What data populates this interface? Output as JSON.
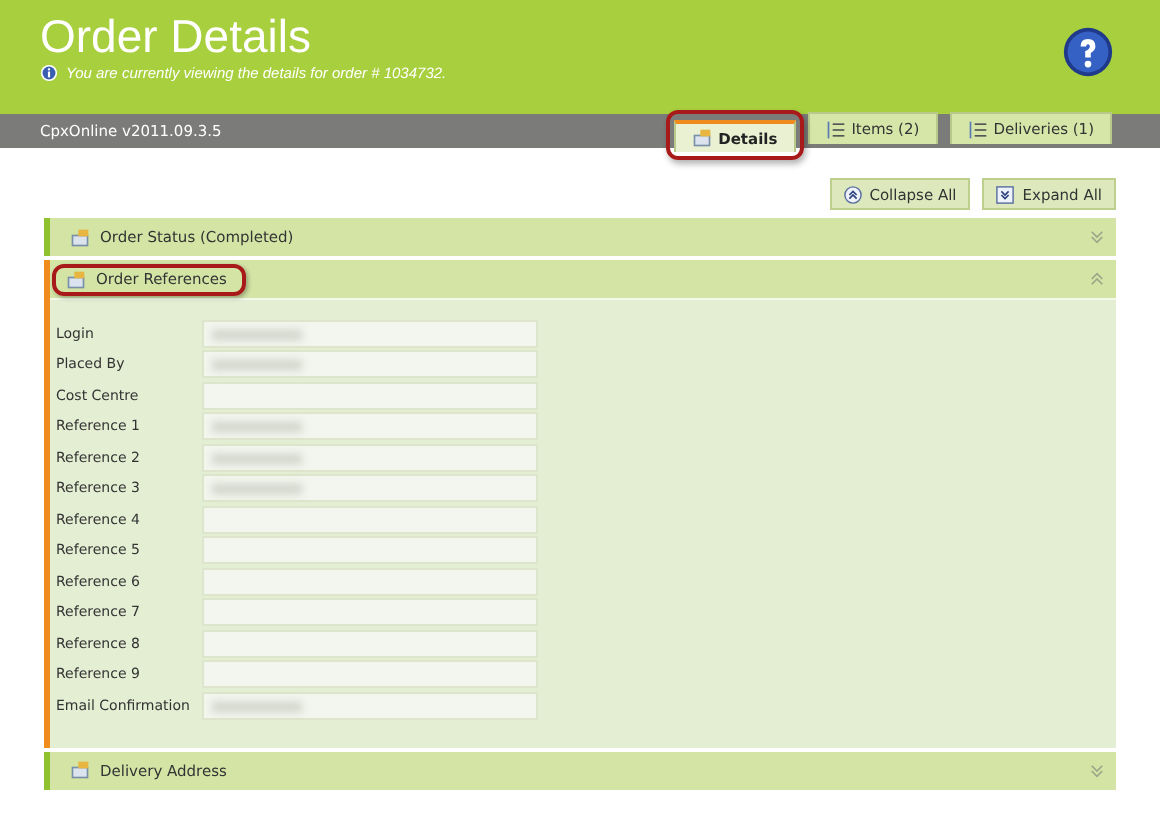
{
  "header": {
    "title": "Order Details",
    "subtitle": "You are currently viewing the details for order # 1034732."
  },
  "version": "CpxOnline v2011.09.3.5",
  "tabs": [
    {
      "label": "Details",
      "selected": true,
      "highlighted": true,
      "kind": "details"
    },
    {
      "label": "Items (2)",
      "selected": false,
      "highlighted": false,
      "kind": "list"
    },
    {
      "label": "Deliveries (1)",
      "selected": false,
      "highlighted": false,
      "kind": "list"
    }
  ],
  "buttons": [
    {
      "label": "Collapse All",
      "kind": "collapse"
    },
    {
      "label": "Expand All",
      "kind": "expand"
    }
  ],
  "sections": [
    {
      "title": "Order Status (Completed)",
      "expanded": false,
      "highlighted": false
    },
    {
      "title": "Order References",
      "expanded": true,
      "highlighted": true,
      "fields": [
        {
          "label": "Login",
          "blurred": true
        },
        {
          "label": "Placed By",
          "blurred": true
        },
        {
          "label": "Cost Centre",
          "blurred": false
        },
        {
          "label": "Reference 1",
          "blurred": true
        },
        {
          "label": "Reference 2",
          "blurred": true
        },
        {
          "label": "Reference 3",
          "blurred": true
        },
        {
          "label": "Reference 4",
          "blurred": false
        },
        {
          "label": "Reference 5",
          "blurred": false
        },
        {
          "label": "Reference 6",
          "blurred": false
        },
        {
          "label": "Reference 7",
          "blurred": false
        },
        {
          "label": "Reference 8",
          "blurred": false
        },
        {
          "label": "Reference 9",
          "blurred": false
        },
        {
          "label": "Email Confirmation",
          "blurred": true
        }
      ]
    },
    {
      "title": "Delivery Address",
      "expanded": false,
      "highlighted": false
    }
  ]
}
